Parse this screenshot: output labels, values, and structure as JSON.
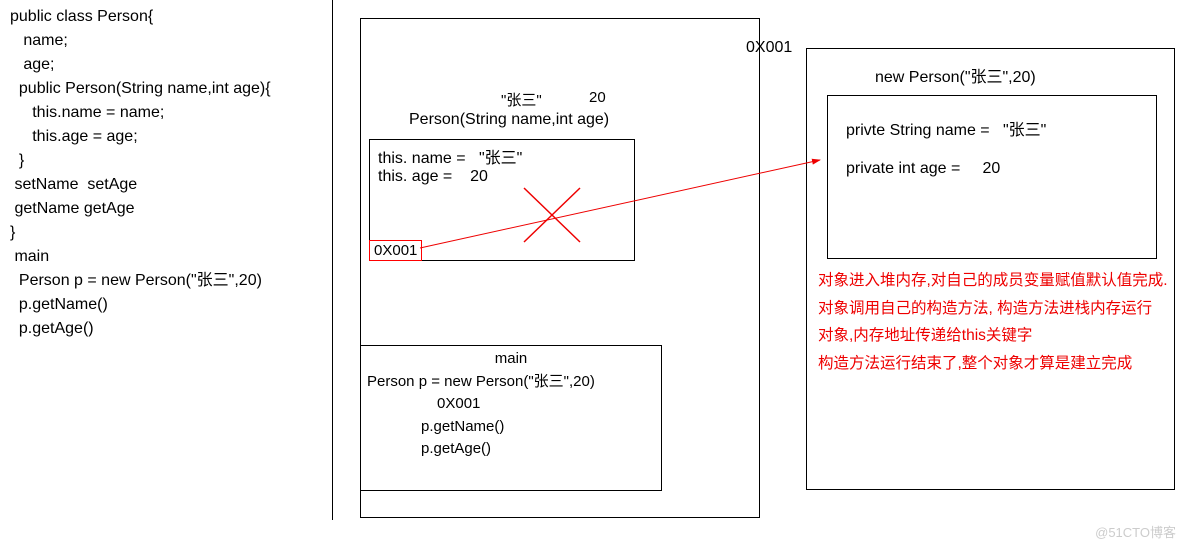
{
  "code": {
    "l1": "public class Person{",
    "l2": "   name;",
    "l3": "   age;",
    "l4": "",
    "l5": "  public Person(String name,int age){",
    "l6": "     this.name = name;",
    "l7": "     this.age = age;",
    "l8": "  }",
    "l9": "",
    "l10": " setName  setAge",
    "l11": " getName getAge",
    "l12": "}",
    "l13": "",
    "l14": "",
    "l15": " main",
    "l16": "",
    "l17": "  Person p = new Person(\"张三\",20)",
    "l18": "",
    "l19": "  p.getName()",
    "l20": "  p.getAge()"
  },
  "middle": {
    "labelAbove1": "\"张三\"",
    "labelAbove2": "20",
    "ctorHeader": "Person(String name,int age)",
    "thisName": "this. name =",
    "thisNameVal": "\"张三\"",
    "thisAge": "this. age =",
    "thisAgeVal": "20",
    "addr": "0X001",
    "mainHeader": "main",
    "mainLine1": "Person p = new Person(\"张三\",20)",
    "mainAddr": "0X001",
    "mainLine3": "p.getName()",
    "mainLine4": "p.getAge()"
  },
  "right": {
    "addrLabel": "0X001",
    "newExpr": "new Person(\"张三\",20)",
    "fieldNameLabel": "privte String name =",
    "fieldNameVal": "\"张三\"",
    "fieldAgeLabel": "private int age =",
    "fieldAgeVal": "20"
  },
  "annotations": {
    "p1": "对象进入堆内存,对自己的成员变量赋值默认值完成.",
    "p2": "对象调用自己的构造方法, 构造方法进栈内存运行",
    "p3": "对象,内存地址传递给this关键字",
    "p4": "构造方法运行结束了,整个对象才算是建立完成"
  },
  "watermark": "@51CTO博客"
}
